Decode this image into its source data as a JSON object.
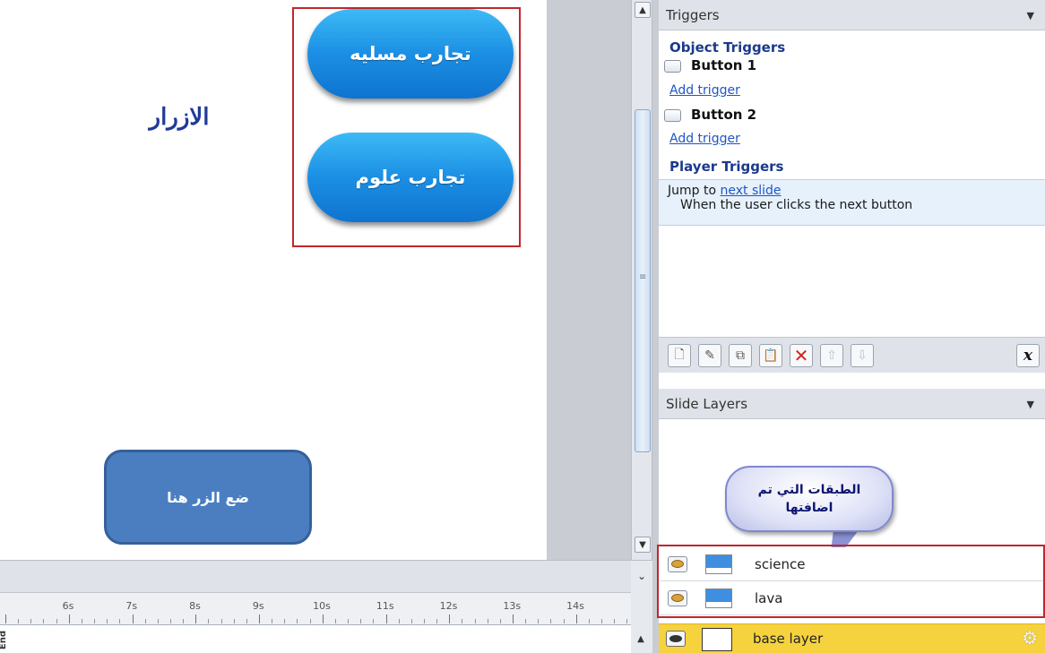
{
  "slide": {
    "heading": "الازرار",
    "buttons": [
      {
        "label": "تجارب مسليه"
      },
      {
        "label": "تجارب علوم"
      }
    ],
    "drop_target_label": "ضع الزر هنا"
  },
  "triggers_panel": {
    "title": "Triggers",
    "object_triggers_heading": "Object Triggers",
    "objects": [
      {
        "name": "Button 1",
        "add_label": "Add trigger"
      },
      {
        "name": "Button 2",
        "add_label": "Add trigger"
      }
    ],
    "player_triggers_heading": "Player Triggers",
    "player_trigger": {
      "action": "Jump to",
      "target": "next slide",
      "condition": "When the user clicks the next button"
    },
    "toolbar": {
      "variables_label": "x"
    }
  },
  "layers_panel": {
    "title": "Slide Layers",
    "callout": "الطبقات التي تم اضافتها",
    "layers": [
      {
        "name": "science"
      },
      {
        "name": "lava"
      }
    ],
    "base_layer": {
      "name": "base layer"
    }
  },
  "timeline": {
    "end_label": "End",
    "ticks": [
      "6s",
      "7s",
      "8s",
      "9s",
      "10s",
      "11s",
      "12s",
      "13s",
      "14s"
    ]
  },
  "colors": {
    "accent_red": "#c0272d",
    "pill_blue": "#1b8fe4",
    "base_layer_yellow": "#f6d23e",
    "heading_blue": "#1f3a9a"
  }
}
